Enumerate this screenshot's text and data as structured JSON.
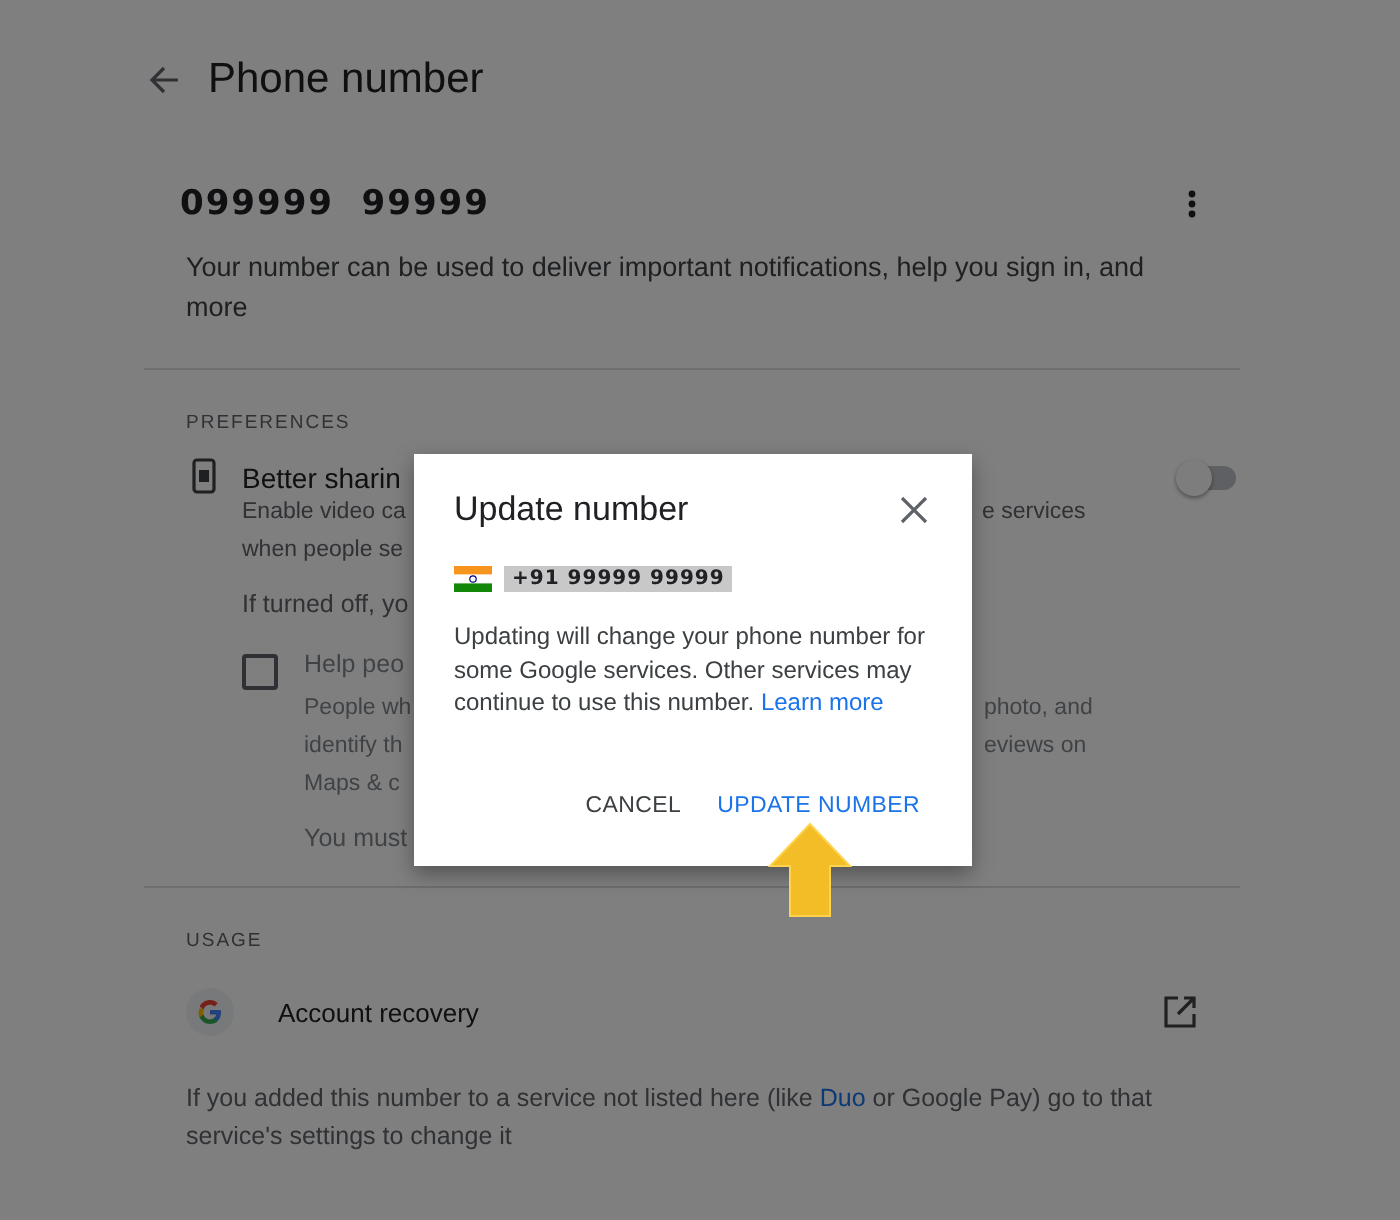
{
  "header": {
    "title": "Phone number"
  },
  "number": {
    "value": "099999  99999",
    "description": "Your number can be used to deliver important notifications, help you sign in, and more"
  },
  "preferences": {
    "heading": "PREFERENCES",
    "title": "Better sharin",
    "toggle_on": false,
    "lines": [
      {
        "left": "Enable video ca",
        "right": "e services"
      },
      {
        "left": "when people se"
      }
    ],
    "note": "If turned off, yo",
    "option": {
      "checked": false,
      "label": "Help peo",
      "lines": [
        {
          "left": "People wh",
          "right": "photo, and"
        },
        {
          "left": "identify th",
          "right": "eviews on"
        },
        {
          "left": "Maps & c"
        }
      ],
      "footnote": "You must"
    }
  },
  "usage": {
    "heading": "USAGE",
    "item": "Account recovery",
    "note_before": "If you added this number to a service not listed here (like ",
    "note_link": "Duo",
    "note_after": " or Google Pay) go to that service's settings to change it"
  },
  "dialog": {
    "title": "Update number",
    "phone": "+91 99999 99999",
    "body": "Updating will change your phone number for some Google services. Other services may continue to use this number.",
    "link": "Learn more",
    "buttons": [
      {
        "label": "CANCEL",
        "kind": "secondary"
      },
      {
        "label": "UPDATE NUMBER",
        "kind": "primary"
      }
    ]
  }
}
